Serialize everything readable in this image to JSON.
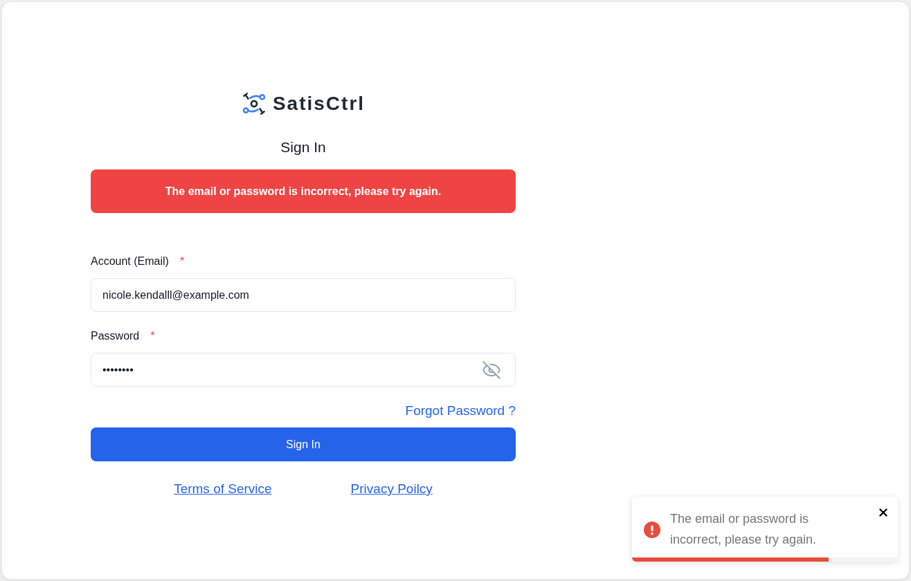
{
  "logo": {
    "name": "SatisCtrl"
  },
  "heading": "Sign In",
  "alert": "The email or password is incorrect, please try again.",
  "form": {
    "fields": [
      {
        "kind": "email",
        "label": "Account (Email)",
        "required_mark": "*",
        "value": "nicole.kendalll@example.com"
      },
      {
        "kind": "password",
        "label": "Password",
        "required_mark": "*",
        "value": "••••••••",
        "revealed": false
      }
    ],
    "forgot_password_link": "Forgot Password ?",
    "submit_button": "Sign In"
  },
  "footer_links": [
    "Terms of Service",
    "Privacy Poilcy"
  ],
  "toast": {
    "message": "The email or password is incorrect, please try again.",
    "level": 0.74
  }
}
